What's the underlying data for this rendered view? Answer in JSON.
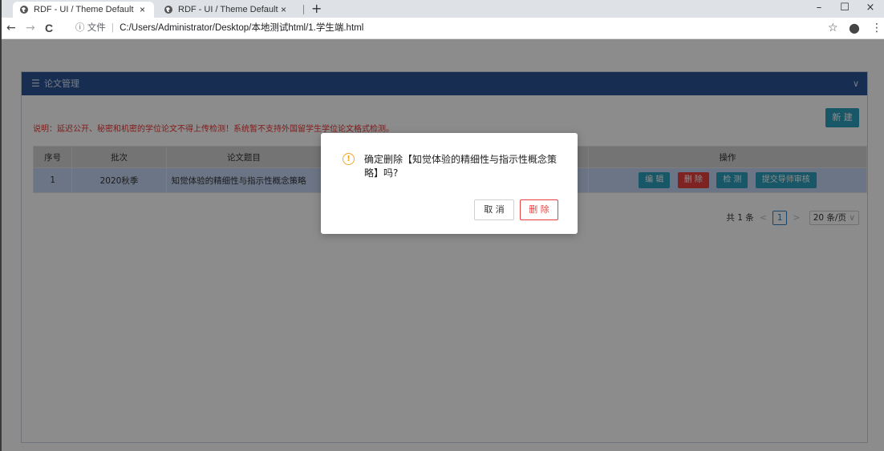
{
  "browser": {
    "tabs": [
      {
        "title": "RDF - UI / Theme Default",
        "close": "×"
      },
      {
        "title": "RDF - UI / Theme Default",
        "close": "×"
      }
    ],
    "new_tab": "+",
    "window": {
      "minimize": "–",
      "maximize": "☐",
      "close": "×"
    },
    "nav": {
      "back": "←",
      "forward": "→",
      "reload": "C"
    },
    "address": {
      "info_icon": "ⓘ",
      "scheme_label": "文件",
      "separator": "|",
      "url": "C:/Users/Administrator/Desktop/本地测试html/1.学生端.html"
    },
    "toolbar_right": {
      "star": "☆",
      "account": "●",
      "menu": "⋮"
    }
  },
  "panel": {
    "menu_icon": "☰",
    "title": "论文管理",
    "chevron": "∨"
  },
  "new_button": "新 建",
  "notice": "说明：延迟公开、秘密和机密的学位论文不得上传检测！系统暂不支持外国留学生学位论文格式检测。",
  "table": {
    "headers": {
      "seq": "序号",
      "batch": "批次",
      "title": "论文题目",
      "ops": "操作"
    },
    "rows": [
      {
        "seq": "1",
        "batch": "2020秋季",
        "title": "知觉体验的精细性与指示性概念策略"
      }
    ],
    "row_actions": {
      "edit": "编 辑",
      "delete": "删 除",
      "check": "检 测",
      "submit": "提交导师审核"
    }
  },
  "pager": {
    "total": "共 1 条",
    "prev": "<",
    "page": "1",
    "next": ">",
    "size": "20 条/页",
    "size_chevron": "∨"
  },
  "dialog": {
    "icon": "!",
    "message": "确定删除【知觉体验的精细性与指示性概念策略】吗?",
    "cancel": "取 消",
    "confirm": "删 除"
  },
  "colors": {
    "header_blue": "#2b5595",
    "accent_teal": "#2c9fbd",
    "danger_red": "#e8413f",
    "warning_orange": "#f5a623"
  }
}
